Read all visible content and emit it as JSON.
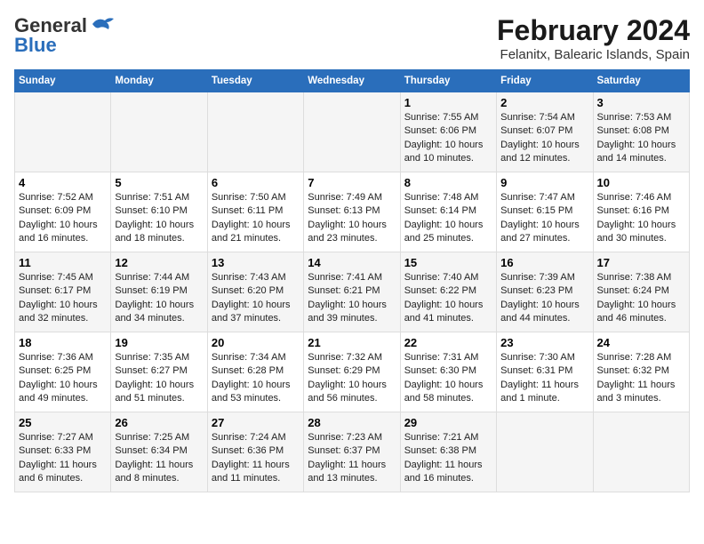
{
  "logo": {
    "line1": "General",
    "line2": "Blue"
  },
  "title": "February 2024",
  "subtitle": "Felanitx, Balearic Islands, Spain",
  "columns": [
    "Sunday",
    "Monday",
    "Tuesday",
    "Wednesday",
    "Thursday",
    "Friday",
    "Saturday"
  ],
  "weeks": [
    [
      {
        "day": "",
        "info": ""
      },
      {
        "day": "",
        "info": ""
      },
      {
        "day": "",
        "info": ""
      },
      {
        "day": "",
        "info": ""
      },
      {
        "day": "1",
        "info": "Sunrise: 7:55 AM\nSunset: 6:06 PM\nDaylight: 10 hours\nand 10 minutes."
      },
      {
        "day": "2",
        "info": "Sunrise: 7:54 AM\nSunset: 6:07 PM\nDaylight: 10 hours\nand 12 minutes."
      },
      {
        "day": "3",
        "info": "Sunrise: 7:53 AM\nSunset: 6:08 PM\nDaylight: 10 hours\nand 14 minutes."
      }
    ],
    [
      {
        "day": "4",
        "info": "Sunrise: 7:52 AM\nSunset: 6:09 PM\nDaylight: 10 hours\nand 16 minutes."
      },
      {
        "day": "5",
        "info": "Sunrise: 7:51 AM\nSunset: 6:10 PM\nDaylight: 10 hours\nand 18 minutes."
      },
      {
        "day": "6",
        "info": "Sunrise: 7:50 AM\nSunset: 6:11 PM\nDaylight: 10 hours\nand 21 minutes."
      },
      {
        "day": "7",
        "info": "Sunrise: 7:49 AM\nSunset: 6:13 PM\nDaylight: 10 hours\nand 23 minutes."
      },
      {
        "day": "8",
        "info": "Sunrise: 7:48 AM\nSunset: 6:14 PM\nDaylight: 10 hours\nand 25 minutes."
      },
      {
        "day": "9",
        "info": "Sunrise: 7:47 AM\nSunset: 6:15 PM\nDaylight: 10 hours\nand 27 minutes."
      },
      {
        "day": "10",
        "info": "Sunrise: 7:46 AM\nSunset: 6:16 PM\nDaylight: 10 hours\nand 30 minutes."
      }
    ],
    [
      {
        "day": "11",
        "info": "Sunrise: 7:45 AM\nSunset: 6:17 PM\nDaylight: 10 hours\nand 32 minutes."
      },
      {
        "day": "12",
        "info": "Sunrise: 7:44 AM\nSunset: 6:19 PM\nDaylight: 10 hours\nand 34 minutes."
      },
      {
        "day": "13",
        "info": "Sunrise: 7:43 AM\nSunset: 6:20 PM\nDaylight: 10 hours\nand 37 minutes."
      },
      {
        "day": "14",
        "info": "Sunrise: 7:41 AM\nSunset: 6:21 PM\nDaylight: 10 hours\nand 39 minutes."
      },
      {
        "day": "15",
        "info": "Sunrise: 7:40 AM\nSunset: 6:22 PM\nDaylight: 10 hours\nand 41 minutes."
      },
      {
        "day": "16",
        "info": "Sunrise: 7:39 AM\nSunset: 6:23 PM\nDaylight: 10 hours\nand 44 minutes."
      },
      {
        "day": "17",
        "info": "Sunrise: 7:38 AM\nSunset: 6:24 PM\nDaylight: 10 hours\nand 46 minutes."
      }
    ],
    [
      {
        "day": "18",
        "info": "Sunrise: 7:36 AM\nSunset: 6:25 PM\nDaylight: 10 hours\nand 49 minutes."
      },
      {
        "day": "19",
        "info": "Sunrise: 7:35 AM\nSunset: 6:27 PM\nDaylight: 10 hours\nand 51 minutes."
      },
      {
        "day": "20",
        "info": "Sunrise: 7:34 AM\nSunset: 6:28 PM\nDaylight: 10 hours\nand 53 minutes."
      },
      {
        "day": "21",
        "info": "Sunrise: 7:32 AM\nSunset: 6:29 PM\nDaylight: 10 hours\nand 56 minutes."
      },
      {
        "day": "22",
        "info": "Sunrise: 7:31 AM\nSunset: 6:30 PM\nDaylight: 10 hours\nand 58 minutes."
      },
      {
        "day": "23",
        "info": "Sunrise: 7:30 AM\nSunset: 6:31 PM\nDaylight: 11 hours\nand 1 minute."
      },
      {
        "day": "24",
        "info": "Sunrise: 7:28 AM\nSunset: 6:32 PM\nDaylight: 11 hours\nand 3 minutes."
      }
    ],
    [
      {
        "day": "25",
        "info": "Sunrise: 7:27 AM\nSunset: 6:33 PM\nDaylight: 11 hours\nand 6 minutes."
      },
      {
        "day": "26",
        "info": "Sunrise: 7:25 AM\nSunset: 6:34 PM\nDaylight: 11 hours\nand 8 minutes."
      },
      {
        "day": "27",
        "info": "Sunrise: 7:24 AM\nSunset: 6:36 PM\nDaylight: 11 hours\nand 11 minutes."
      },
      {
        "day": "28",
        "info": "Sunrise: 7:23 AM\nSunset: 6:37 PM\nDaylight: 11 hours\nand 13 minutes."
      },
      {
        "day": "29",
        "info": "Sunrise: 7:21 AM\nSunset: 6:38 PM\nDaylight: 11 hours\nand 16 minutes."
      },
      {
        "day": "",
        "info": ""
      },
      {
        "day": "",
        "info": ""
      }
    ]
  ]
}
